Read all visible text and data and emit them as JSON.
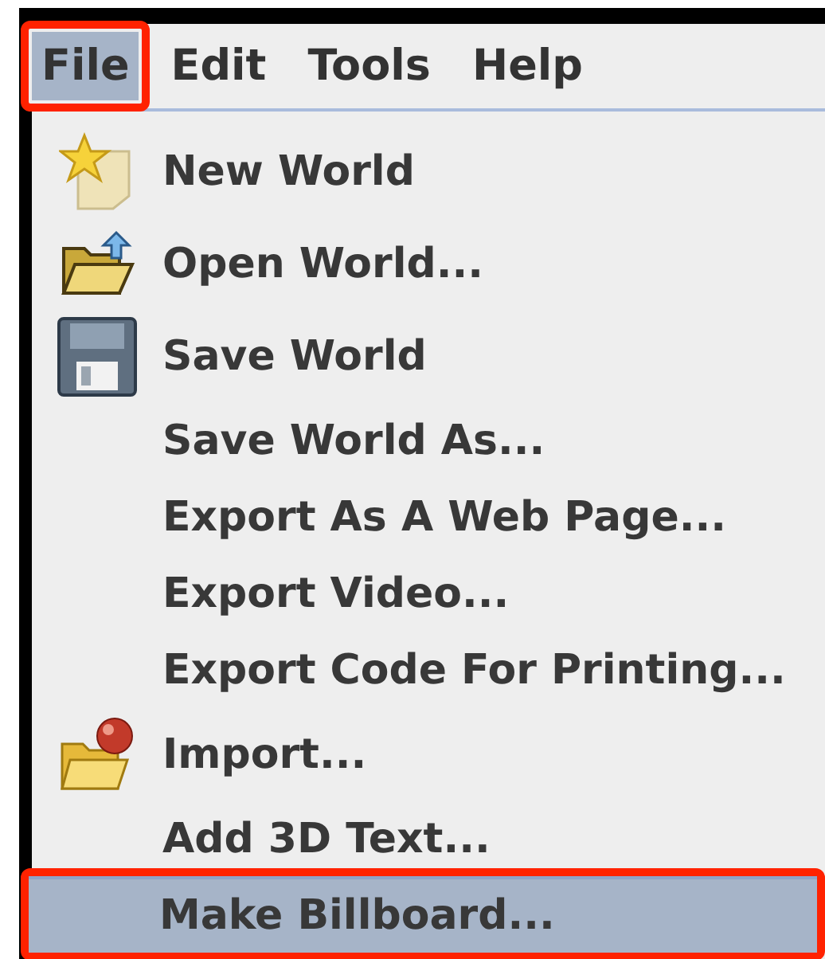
{
  "menu_bar": [
    {
      "label": "File",
      "selected": true
    },
    {
      "label": "Edit",
      "selected": false
    },
    {
      "label": "Tools",
      "selected": false
    },
    {
      "label": "Help",
      "selected": false
    }
  ],
  "file_menu": [
    {
      "label": "New World",
      "kind": "new",
      "selected": false
    },
    {
      "label": "Open World...",
      "kind": "open",
      "selected": false
    },
    {
      "label": "Save World",
      "kind": "save",
      "selected": false
    },
    {
      "label": "Save World As...",
      "kind": "plain",
      "selected": false
    },
    {
      "label": "Export As A Web Page...",
      "kind": "plain",
      "selected": false
    },
    {
      "label": "Export Video...",
      "kind": "plain",
      "selected": false
    },
    {
      "label": "Export Code For Printing...",
      "kind": "plain",
      "selected": false
    },
    {
      "label": "Import...",
      "kind": "import",
      "selected": false
    },
    {
      "label": "Add 3D Text...",
      "kind": "plain",
      "selected": false
    },
    {
      "label": "Make Billboard...",
      "kind": "plain",
      "selected": true
    }
  ]
}
